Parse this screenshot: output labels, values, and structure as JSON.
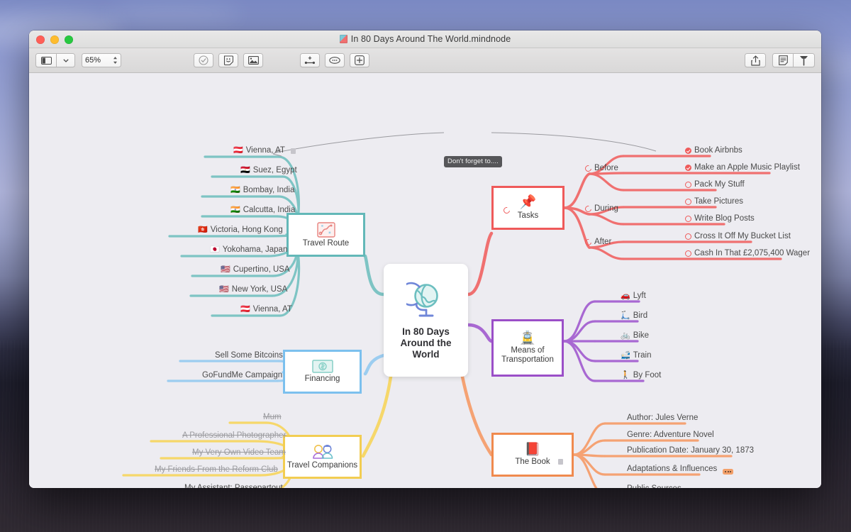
{
  "window": {
    "doc_title": "In 80 Days Around The World.mindnode",
    "doc_icon": "mindnode-document-icon",
    "traffic_lights": [
      "close",
      "minimize",
      "zoom"
    ]
  },
  "toolbar": {
    "sidebar_toggle_icon": "sidebar-panel-icon",
    "sidebar_chevron_icon": "chevron-down-icon",
    "zoom_value": "65%",
    "zoom_stepper_icon": "stepper-up-down-icon",
    "task_icon": "check-circle-icon",
    "sticker_icon": "sticker-smiley-icon",
    "image_icon": "image-icon",
    "node_icon": "add-node-icon",
    "comment_icon": "comment-bubble-icon",
    "add_icon": "add-box-icon",
    "share_icon": "share-upload-icon",
    "notes_icon": "document-notes-icon",
    "inspector_icon": "style-inspector-icon"
  },
  "mindmap": {
    "center": {
      "title_lines": [
        "In 80 Days",
        "Around the",
        "World"
      ],
      "icon": "globe-on-stand-icon"
    },
    "note_callout": "Don't forget to....",
    "branches": [
      {
        "id": "travel-route",
        "label": "Travel Route",
        "icon": "map-route-icon",
        "color": "#63b8b8",
        "children": [
          {
            "flag": "🇦🇹",
            "text": "Vienna, AT",
            "note": true
          },
          {
            "flag": "🇪🇬",
            "text": "Suez, Egypt"
          },
          {
            "flag": "🇮🇳",
            "text": "Bombay, India"
          },
          {
            "flag": "🇮🇳",
            "text": "Calcutta, India"
          },
          {
            "flag": "🇭🇰",
            "text": "Victoria, Hong Kong"
          },
          {
            "flag": "🇯🇵",
            "text": "Yokohama, Japan"
          },
          {
            "flag": "🇺🇸",
            "text": "Cupertino, USA"
          },
          {
            "flag": "🇺🇸",
            "text": "New York, USA"
          },
          {
            "flag": "🇦🇹",
            "text": "Vienna, AT"
          }
        ]
      },
      {
        "id": "financing",
        "label": "Financing",
        "icon": "money-bill-icon",
        "color": "#7cc0ee",
        "children": [
          {
            "text": "Sell Some Bitcoins"
          },
          {
            "text": "GoFundMe Campaign"
          }
        ]
      },
      {
        "id": "travel-companions",
        "label": "Travel Companions",
        "icon": "two-people-icon",
        "color": "#f2cd52",
        "children": [
          {
            "text": "Mum",
            "struck": true
          },
          {
            "text": "A Professional Photographer",
            "struck": true
          },
          {
            "text": "My Very Own Video Team",
            "struck": true
          },
          {
            "text": "My Friends From the Reform Club",
            "struck": true
          },
          {
            "text": "My Assistant: Passepartout",
            "struck": false
          }
        ]
      },
      {
        "id": "tasks",
        "label": "Tasks",
        "icon": "pushpin-icon",
        "color": "#ef5a5a",
        "progress_icon": "progress-circle-icon",
        "groups": [
          {
            "label": "Before",
            "items": [
              {
                "text": "Book Airbnbs",
                "done": true
              },
              {
                "text": "Make an Apple Music Playlist",
                "done": true
              },
              {
                "text": "Pack My Stuff",
                "done": false
              }
            ]
          },
          {
            "label": "During",
            "items": [
              {
                "text": "Take Pictures",
                "done": false
              },
              {
                "text": "Write Blog Posts",
                "done": false
              }
            ]
          },
          {
            "label": "After",
            "items": [
              {
                "text": "Cross It Off My Bucket List",
                "done": false
              },
              {
                "text": "Cash In That £2,075,400 Wager",
                "done": false
              }
            ]
          }
        ]
      },
      {
        "id": "means-of-transportation",
        "label_lines": [
          "Means of",
          "Transportation"
        ],
        "icon": "tram-icon",
        "color": "#9b4fc8",
        "children": [
          {
            "emoji": "🚗",
            "text": "Lyft"
          },
          {
            "emoji": "🛴",
            "text": "Bird"
          },
          {
            "emoji": "🚲",
            "text": "Bike"
          },
          {
            "emoji": "🚅",
            "text": "Train"
          },
          {
            "emoji": "🚶",
            "text": "By Foot"
          }
        ]
      },
      {
        "id": "the-book",
        "label": "The Book",
        "icon": "closed-book-icon",
        "color": "#f08a4e",
        "note": true,
        "children": [
          {
            "text": "Author: Jules Verne"
          },
          {
            "text": "Genre: Adventure Novel"
          },
          {
            "text": "Publication Date: January 30, 1873"
          },
          {
            "text": "Adaptations & Influences",
            "collapsed": true
          },
          {
            "text": "Public Sources",
            "collapsed": true
          }
        ]
      }
    ]
  }
}
